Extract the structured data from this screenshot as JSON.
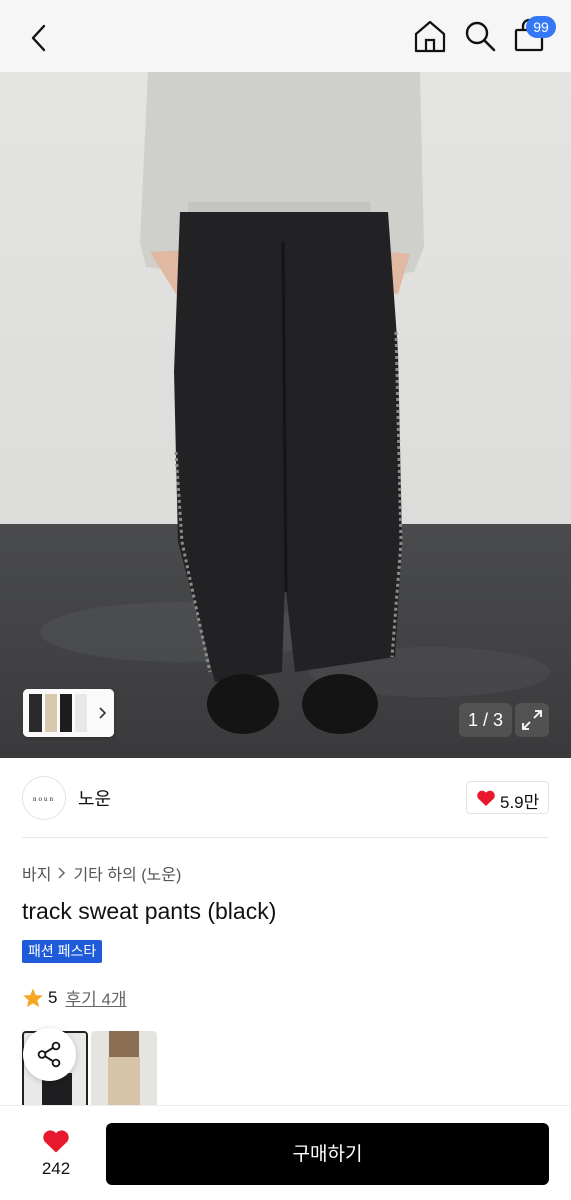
{
  "header": {
    "cart_count": "99",
    "icons": [
      "back-arrow-icon",
      "home-icon",
      "search-icon",
      "shopping-bag-icon"
    ]
  },
  "gallery": {
    "counter": "1 / 3",
    "current": 1,
    "total": 3
  },
  "shop": {
    "logo_text": "noun",
    "name": "노운",
    "like_count": "5.9만"
  },
  "breadcrumb": [
    "바지",
    "기타 하의 (노운)"
  ],
  "product": {
    "title": "track sweat pants (black)",
    "tag": "패션 페스타",
    "rating": "5",
    "reviews": "후기 4개"
  },
  "bottom_bar": {
    "wish_count": "242",
    "buy_label": "구매하기"
  },
  "colors": {
    "accent_blue": "#3478f6",
    "tag_blue": "#1f5bd8",
    "heart_red": "#e8192c",
    "star_gold": "#f5a623",
    "buy_button": "#000000"
  }
}
